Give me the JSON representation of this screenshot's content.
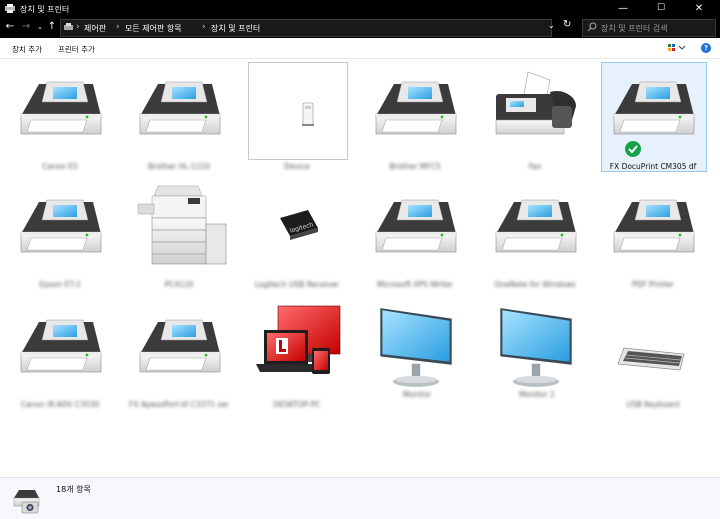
{
  "window": {
    "title": "장치 및 프린터"
  },
  "address": {
    "crumbs": [
      "제어판",
      "모든 제어판 항목",
      "장치 및 프린터"
    ]
  },
  "search": {
    "placeholder": "장치 및 프린터 검색"
  },
  "commands": {
    "add_device": "장치 추가",
    "add_printer": "프린터 추가"
  },
  "devices": [
    {
      "label": "Canon E5",
      "icon": "printer-icon"
    },
    {
      "label": "Brother HL-1210",
      "icon": "printer-icon"
    },
    {
      "label": "Device",
      "icon": "device-box-icon"
    },
    {
      "label": "Brother MFC5",
      "icon": "printer-icon"
    },
    {
      "label": "Fax",
      "icon": "fax-icon"
    },
    {
      "label": "FX DocuPrint CM305 df",
      "icon": "printer-icon",
      "default": true
    },
    {
      "label": "Epson ET-2",
      "icon": "printer-icon"
    },
    {
      "label": "PC4120",
      "icon": "copier-icon"
    },
    {
      "label": "Logitech USB Receiver",
      "icon": "usb-receiver-icon"
    },
    {
      "label": "Microsoft XPS Writer",
      "icon": "printer-icon"
    },
    {
      "label": "OneNote for Windows",
      "icon": "printer-icon"
    },
    {
      "label": "PDF Printer",
      "icon": "printer-icon"
    },
    {
      "label": "Canon iR-ADV C3530",
      "icon": "printer-icon"
    },
    {
      "label": "FX ApeosPort-VI C3371 series",
      "icon": "printer-icon"
    },
    {
      "label": "DESKTOP-PC",
      "icon": "computer-devices-icon"
    },
    {
      "label": "Monitor",
      "icon": "monitor-icon"
    },
    {
      "label": "Monitor 2",
      "icon": "monitor-icon"
    },
    {
      "label": "USB Keyboard",
      "icon": "keyboard-icon"
    }
  ],
  "status": {
    "count_text": "18개 항목"
  }
}
